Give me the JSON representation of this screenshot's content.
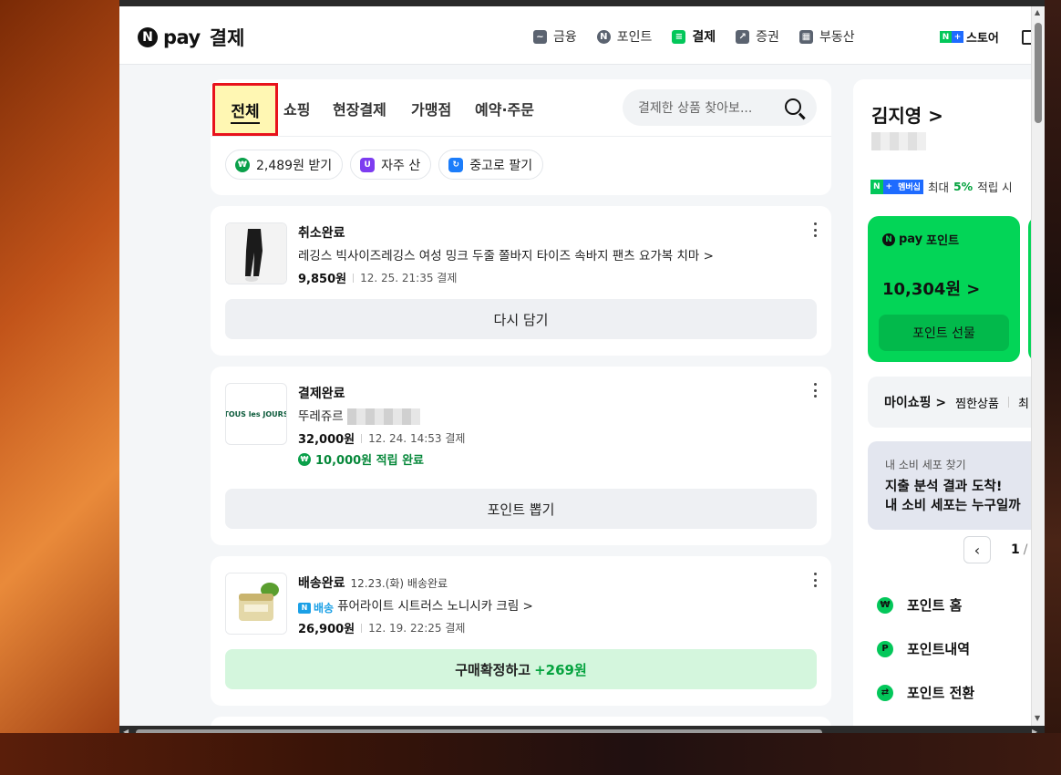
{
  "header": {
    "logo_n": "N",
    "logo_pay": "pay",
    "logo_title": "결제",
    "nav": [
      {
        "label": "금융",
        "icon": "wallet-icon"
      },
      {
        "label": "포인트",
        "icon": "point-icon"
      },
      {
        "label": "결제",
        "icon": "payment-icon",
        "active": true
      },
      {
        "label": "증권",
        "icon": "chart-icon"
      },
      {
        "label": "부동산",
        "icon": "building-icon"
      }
    ],
    "store_label": "스토어"
  },
  "tabs": {
    "items": [
      "전체",
      "쇼핑",
      "현장결제",
      "가맹점",
      "예약·주문"
    ],
    "selected": "전체"
  },
  "search": {
    "placeholder": "결제한 상품 찾아보..."
  },
  "chips": [
    {
      "label": "2,489원 받기"
    },
    {
      "label": "자주 산"
    },
    {
      "label": "중고로 팔기"
    }
  ],
  "orders": [
    {
      "status": "취소완료",
      "status_sub": "",
      "product": "레깅스 빅사이즈레깅스 여성 밍크 두줄 쫄바지 타이즈 속바지 팬츠 요가복 치마 >",
      "price": "9,850원",
      "date": "12. 25. 21:35 결제",
      "action": "다시 담기"
    },
    {
      "status": "결제완료",
      "status_sub": "",
      "product": "뚜레쥬르",
      "price": "32,000원",
      "date": "12. 24. 14:53 결제",
      "reward": "10,000원 적립 완료",
      "action": "포인트 뽑기",
      "thumb_text": "TOUS les JOURS"
    },
    {
      "status": "배송완료",
      "status_sub": "12.23.(화) 배송완료",
      "delivery_badge": "배송",
      "product": "퓨어라이트 시트러스 노니시카 크림 >",
      "price": "26,900원",
      "date": "12. 19. 22:25 결제",
      "action": "구매확정하고",
      "action_highlight": "+269원"
    }
  ],
  "side": {
    "user_name": "김지영 >",
    "membership_badge_n": "N",
    "membership_badge_plus": "+",
    "membership_badge_text": "멤버십",
    "membership_text": "최대",
    "membership_rate": "5%",
    "membership_suffix": "적립 시",
    "point_card": {
      "title": "포인트",
      "pay": "pay",
      "amount": "10,304원 >",
      "button": "포인트 선물"
    },
    "myshop_label": "마이쇼핑 >",
    "myshop_sub": "찜한상품",
    "myshop_more": "최",
    "banner_small": "내 소비 세포 찾기",
    "banner_line1": "지출 분석 결과 도착!",
    "banner_line2": "내 소비 세포는 누구일까",
    "pager_current": "1",
    "pager_sep": "/",
    "menu": [
      "포인트 홈",
      "포인트내역",
      "포인트 전환"
    ]
  },
  "colors": {
    "brand_green": "#03c75a",
    "point_card": "#03d557",
    "highlight_border": "#e8121c",
    "highlight_fill": "#fff7b3"
  }
}
